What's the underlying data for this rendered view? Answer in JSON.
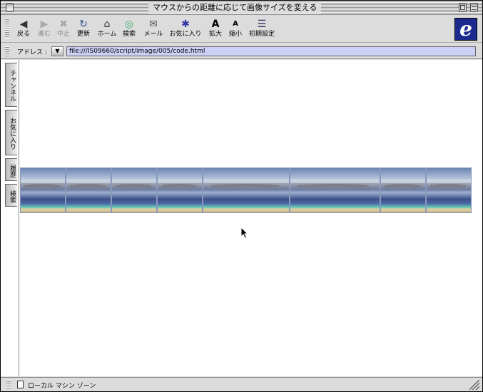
{
  "window": {
    "title": "マウスからの距離に応じて画像サイズを変える"
  },
  "toolbar": {
    "buttons": [
      {
        "label": "戻る",
        "icon": "back-arrow-icon",
        "glyph": "◀",
        "enabled": true
      },
      {
        "label": "進む",
        "icon": "forward-arrow-icon",
        "glyph": "▶",
        "enabled": false
      },
      {
        "label": "中止",
        "icon": "stop-icon",
        "glyph": "✖",
        "enabled": false
      },
      {
        "label": "更新",
        "icon": "refresh-icon",
        "glyph": "↻",
        "enabled": true
      },
      {
        "label": "ホーム",
        "icon": "home-icon",
        "glyph": "⌂",
        "enabled": true
      },
      {
        "label": "検索",
        "icon": "search-icon",
        "glyph": "◎",
        "enabled": true
      },
      {
        "label": "メール",
        "icon": "mail-icon",
        "glyph": "✉",
        "enabled": true
      },
      {
        "label": "お気に入り",
        "icon": "favorites-icon",
        "glyph": "✱",
        "enabled": true
      },
      {
        "label": "拡大",
        "icon": "text-larger-icon",
        "glyph": "A",
        "enabled": true
      },
      {
        "label": "縮小",
        "icon": "text-smaller-icon",
        "glyph": "A",
        "enabled": true
      },
      {
        "label": "初期設定",
        "icon": "preferences-icon",
        "glyph": "☰",
        "enabled": true
      }
    ]
  },
  "address": {
    "label": "アドレス :",
    "url": "file:///IS09660/script/image/005/code.html"
  },
  "sidebar": {
    "tabs": [
      "チャンネル",
      "お気に入り",
      "履歴",
      "検索"
    ]
  },
  "content": {
    "image_count": 10
  },
  "status": {
    "text": "ローカル マシン ゾーン"
  },
  "colors": {
    "address_field": "#cdd0f5",
    "ie_logo": "#1b2a8c"
  }
}
